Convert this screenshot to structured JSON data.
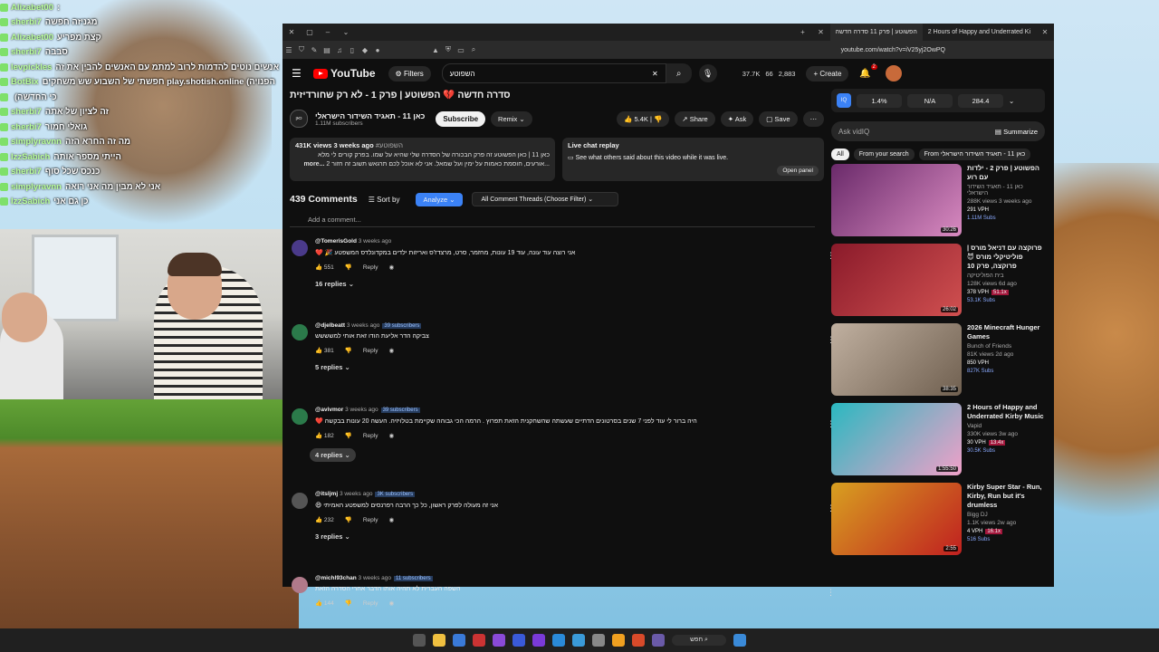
{
  "chat": [
    {
      "user": "Alizabet00",
      "msg": ":",
      "color": "#7fe06a"
    },
    {
      "user": "sherbi7",
      "msg": "מגניזה חפשה",
      "color": "#7fe06a"
    },
    {
      "user": "Alizabet00",
      "msg": "קצת מפריע",
      "color": "#7fe06a"
    },
    {
      "user": "sherbi7",
      "msg": "סבבה",
      "color": "#7fe06a"
    },
    {
      "user": "levpickles",
      "msg": "אנשים נוטים להדמות לרוב למתמ עם האנשים להבין את זה",
      "color": "#7fe06a"
    },
    {
      "user": "BotBix",
      "msg": "חפשתי של השבוע שש משחקים play.shotish.online (הפנויה",
      "color": "#7fe06a"
    },
    {
      "user": "",
      "msg": "(כי החדשה",
      "color": "#7fe06a"
    },
    {
      "user": "sherbi7",
      "msg": "זה לציון של אתה",
      "color": "#7fe06a"
    },
    {
      "user": "sherbi7",
      "msg": "גואלי חמור",
      "color": "#7fe06a"
    },
    {
      "user": "simplyravnn",
      "msg": "מה זה החרא הזה",
      "color": "#7fe06a"
    },
    {
      "user": "IzzSabich",
      "msg": "הייתי מספר אותה",
      "color": "#7fe06a"
    },
    {
      "user": "sherbi7",
      "msg": "כנכס שכל סוף",
      "color": "#7fe06a"
    },
    {
      "user": "simplyravnn",
      "msg": "אני לא מבין מה אני רואה",
      "color": "#7fe06a"
    },
    {
      "user": "IzzSabich",
      "msg": "כן גם אני",
      "color": "#7fe06a"
    }
  ],
  "browser": {
    "tabs": [
      "הפשוטע | פרק 11 סדרה חדשה",
      "2 Hours of Happy and Underrated Ki"
    ],
    "url": "youtube.com/watch?v=iV25yj2OwPQ"
  },
  "yt": {
    "logo": "YouTube",
    "filters": "Filters",
    "search_value": "השפוטע",
    "stats": [
      "37.7K",
      "66",
      "2,883"
    ],
    "create": "Create",
    "notif_count": "2",
    "title": "סדרה חדשה 💔 הפשוטע | פרק 1 - לא רק שחורדיזית",
    "channel": "כאן 11 - תאגיד השידור הישראלי",
    "subs": "1.11M subscribers",
    "subscribe": "Subscribe",
    "remix": "Remix",
    "likes": "5.4K",
    "share": "Share",
    "ask": "Ask",
    "save": "Save",
    "desc_meta": "431K views  3 weeks ago",
    "desc_tag": "#השפוטע",
    "desc_text": "כאן 11 | כאן הפשוטע זה פרק הבכורה של הסדרה שלי שהיא על שמו. בפרק קורים לי מלא ...אורעים, חוסמת כאמות על ימין ועל שמאל. אני לא אוכל לכם תרגאש תשוב זה חזור 2",
    "desc_more": "...more",
    "live_title": "Live chat replay",
    "live_text": "See what others said about this video while it was live.",
    "open_panel": "Open panel",
    "comments_count": "439 Comments",
    "sort_by": "Sort by",
    "analyze": "Analyze",
    "filter": "All Comment Threads (Choose Filter)",
    "add_comment": "Add a comment...",
    "comments": [
      {
        "user": "@TomerisGold",
        "time": "3 weeks ago",
        "subs": "",
        "body": "אני רוצה עוד עונה, עוד 19 עונות, מחזמר, סרט, מרצדז'ס ואריזות ילדים במקדונלדס המשפטע 🎉 ❤️",
        "likes": "551",
        "replies": "16 replies",
        "av": "#4a3a8a"
      },
      {
        "user": "@djelbeatt",
        "time": "3 weeks ago",
        "subs": "39 subscribers",
        "body": "צביקה הדר אליעת הודו זאת אותי למשששש",
        "likes": "381",
        "replies": "5 replies",
        "av": "#2b7a4a"
      },
      {
        "user": "@avivmor",
        "time": "3 weeks ago",
        "subs": "39 subscribers",
        "body": "היה ברור לי עוד לפני 7 שנים בסרטונים הדתיים שעשתה שהשחקנית הזאת תפרוץ . הרמה הכי גבוהה שקיימת בטלויזיה. העשה 20 עונות בבקשה ❤️",
        "likes": "182",
        "replies": "4 replies",
        "av": "#2b7a4a"
      },
      {
        "user": "@itsljmj",
        "time": "3 weeks ago",
        "subs": "3K subscribers",
        "body": "אני זה מעולה לפרק ראשון, כל כך הרבה רפרנסים למשפטע האמיתי 😄",
        "likes": "232",
        "replies": "3 replies",
        "av": "#555"
      },
      {
        "user": "@michl93chan",
        "time": "3 weeks ago",
        "subs": "11 subscribers",
        "body": "השפה העברית לא תהיה אותו הדבר אחרי הסדרה הזאת",
        "likes": "144",
        "replies": "",
        "av": "#b07a8a"
      }
    ],
    "reply": "Reply"
  },
  "sidebar": {
    "iq": "IQ",
    "metrics": [
      "1.4%",
      "N/A",
      "284.4"
    ],
    "ask": "Ask vidIQ",
    "summarize": "Summarize",
    "chips": [
      "All",
      "From your search",
      "From כאן 11 - תאגיד השידור הישראלי"
    ],
    "recs": [
      {
        "title": "הפשוטע | פרק 2 - ילדות עם רוע",
        "channel": "כאן 11 - תאגיד השידור הישראלי",
        "meta": "288K views  3 weeks ago",
        "vph": "291 VPH",
        "badge": "",
        "subs": "1.11M Subs",
        "dur": "30:26",
        "c1": "#6a2a6a",
        "c2": "#d88ac0"
      },
      {
        "title": "פרוקצה עם דניאל מורס | פוליטיקלי מורס 😈 פרוקצה, פרק 10",
        "channel": "בית הפוליטיקה",
        "meta": "128K views  6d ago",
        "vph": "378 VPH",
        "badge": "51.1x",
        "subs": "53.1K Subs",
        "dur": "26:02",
        "c1": "#8a1a2a",
        "c2": "#d05050"
      },
      {
        "title": "2026 Minecraft Hunger Games",
        "channel": "Bunch of Friends",
        "meta": "81K views  2d ago",
        "vph": "850 VPH",
        "badge": "",
        "subs": "827K Subs",
        "dur": "38:35",
        "c1": "#c0b0a0",
        "c2": "#706050"
      },
      {
        "title": "2 Hours of Happy and Underrated Kirby Music",
        "channel": "Vapid",
        "meta": "330K views  3w ago",
        "vph": "30 VPH",
        "badge": "13.4x",
        "subs": "30.5K Subs",
        "dur": "1:55:50",
        "c1": "#2ab8c0",
        "c2": "#f0a0c8"
      },
      {
        "title": "Kirby Super Star - Run, Kirby, Run but it's drumless",
        "channel": "Bigg DJ",
        "meta": "1.1K views  2w ago",
        "vph": "4 VPH",
        "badge": "16.1x",
        "subs": "516 Subs",
        "dur": "2:55",
        "c1": "#d8a020",
        "c2": "#c02020"
      }
    ]
  },
  "taskbar": {
    "search": "חפש"
  }
}
